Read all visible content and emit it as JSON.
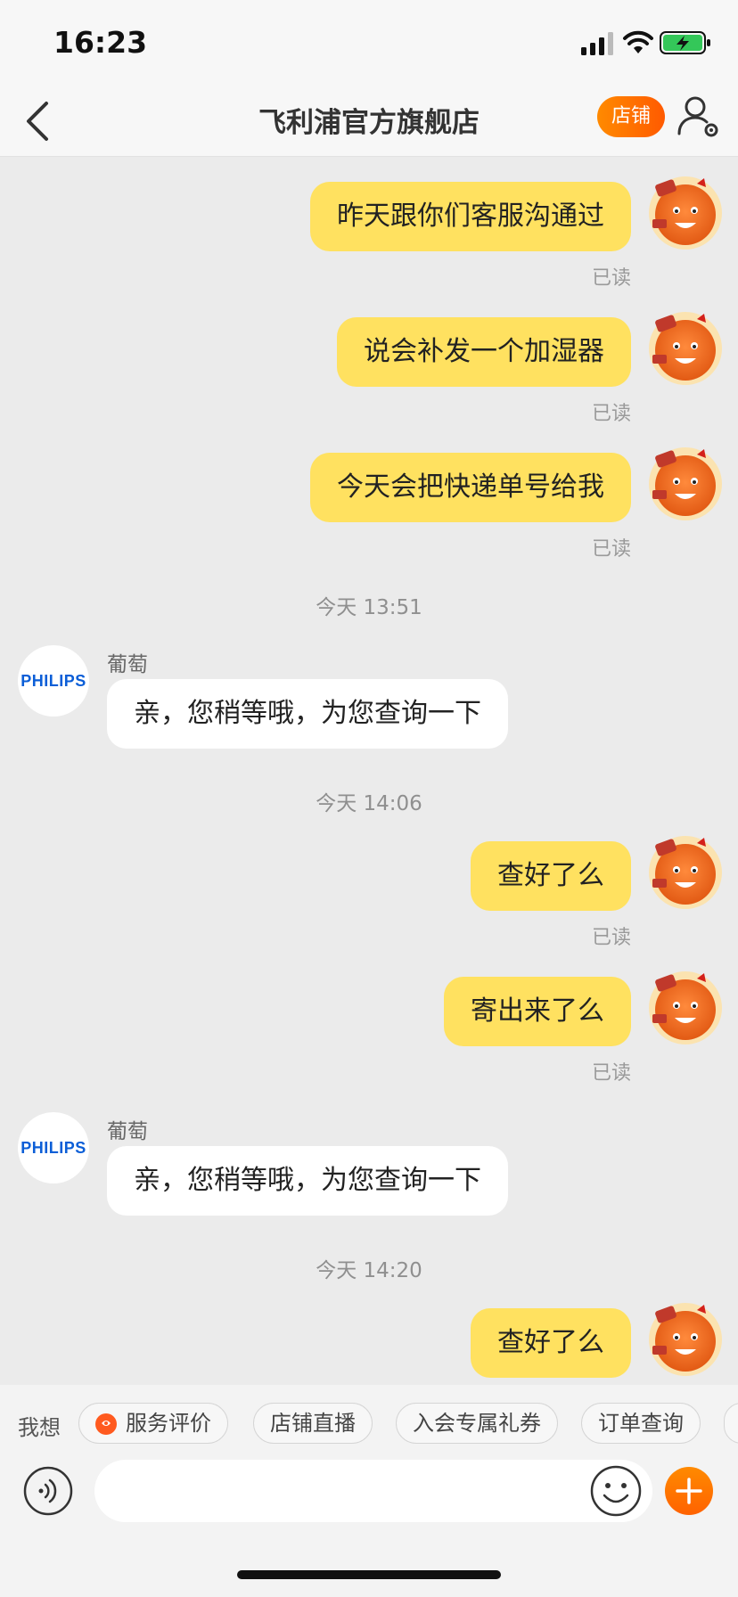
{
  "status": {
    "time": "16:23"
  },
  "nav": {
    "title": "飞利浦官方旗舰店",
    "shop_button": "店铺"
  },
  "messages": [
    {
      "text": "昨天跟你们客服沟通过",
      "read": "已读"
    },
    {
      "text": "说会补发一个加湿器",
      "read": "已读"
    },
    {
      "text": "今天会把快递单号给我",
      "read": "已读"
    },
    {
      "timestamp": "今天 13:51"
    },
    {
      "sender": "葡萄",
      "avatar_text": "PHILIPS",
      "text": "亲，您稍等哦，为您查询一下"
    },
    {
      "timestamp": "今天 14:06"
    },
    {
      "text": "查好了么",
      "read": "已读"
    },
    {
      "text": "寄出来了么",
      "read": "已读"
    },
    {
      "sender": "葡萄",
      "avatar_text": "PHILIPS",
      "text": "亲，您稍等哦，为您查询一下"
    },
    {
      "timestamp": "今天 14:20"
    },
    {
      "text": "查好了么"
    }
  ],
  "quick_bar": {
    "label": "我想",
    "chips": [
      "服务评价",
      "店铺直播",
      "入会专属礼券",
      "订单查询"
    ]
  },
  "input": {
    "placeholder": ""
  },
  "colors": {
    "accent": "#ff6a00",
    "my_bubble": "#ffe160",
    "their_bubble": "#ffffff"
  }
}
